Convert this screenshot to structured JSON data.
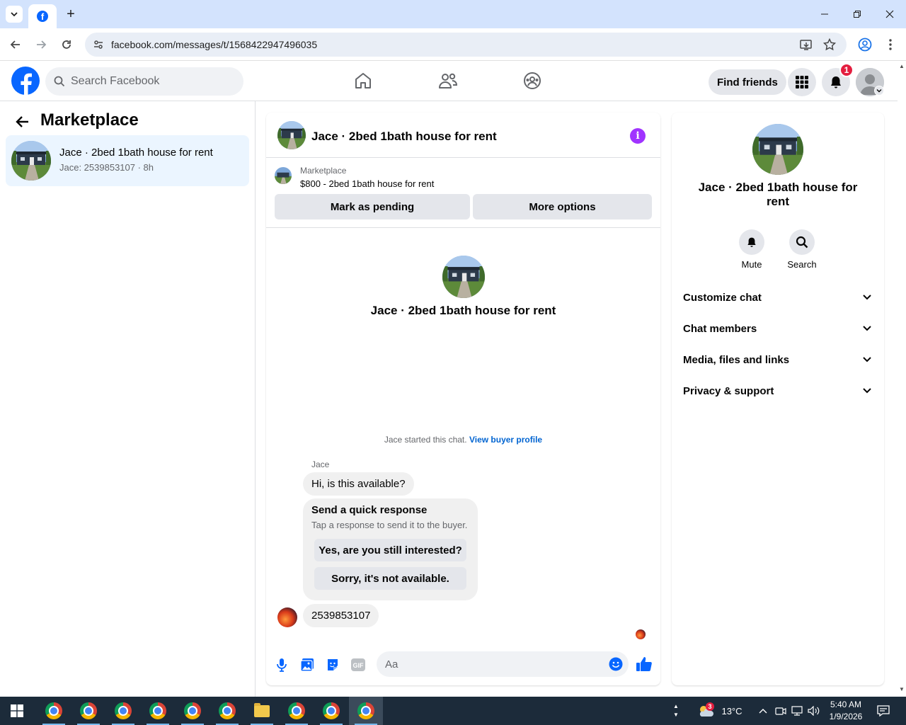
{
  "browser": {
    "url": "facebook.com/messages/t/1568422947496035",
    "tab_icon": "facebook-icon",
    "new_tab_label": "+"
  },
  "fb_header": {
    "search_placeholder": "Search Facebook",
    "find_friends_label": "Find friends",
    "notification_count": "1",
    "nav_icons": [
      "home-icon",
      "friends-icon",
      "groups-icon"
    ]
  },
  "left_panel": {
    "title": "Marketplace",
    "conversations": [
      {
        "name": "Jace · 2bed 1bath house for rent",
        "preview": "Jace: 2539853107 · 8h"
      }
    ]
  },
  "chat": {
    "title": "Jace · 2bed 1bath house for rent",
    "listing_label": "Marketplace",
    "listing_desc": "$800 - 2bed 1bath house for rent",
    "mark_pending_label": "Mark as pending",
    "more_options_label": "More options",
    "center_name": "Jace · 2bed 1bath house for rent",
    "started_text": "Jace started this chat.",
    "view_buyer_label": "View buyer profile",
    "sender_name": "Jace",
    "incoming_message": "Hi, is this available?",
    "quick_response": {
      "title": "Send a quick response",
      "subtitle": "Tap a response to send it to the buyer.",
      "options": [
        "Yes, are you still interested?",
        "Sorry, it's not available."
      ]
    },
    "outgoing_message": "2539853107",
    "composer_placeholder": "Aa"
  },
  "right_panel": {
    "name": "Jace · 2bed 1bath house for rent",
    "actions": [
      {
        "label": "Mute",
        "icon": "bell-icon"
      },
      {
        "label": "Search",
        "icon": "search-icon"
      }
    ],
    "sections": [
      "Customize chat",
      "Chat members",
      "Media, files and links",
      "Privacy & support"
    ]
  },
  "taskbar": {
    "weather_badge": "3",
    "temperature": "13°C",
    "time": "5:40 AM",
    "date": "1/9/2026"
  },
  "colors": {
    "facebook_blue": "#0866ff",
    "messenger_purple": "#a033ff",
    "link_blue": "#0064d1",
    "selected_conv_bg": "#ebf5ff",
    "notif_red": "#e41e3f"
  }
}
